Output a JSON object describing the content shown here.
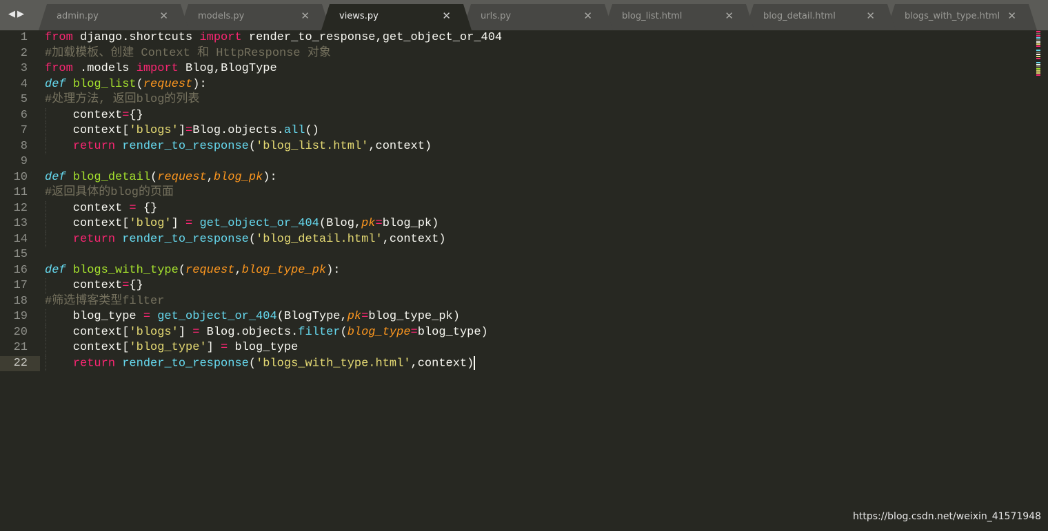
{
  "tabs": [
    {
      "label": "admin.py",
      "active": false
    },
    {
      "label": "models.py",
      "active": false
    },
    {
      "label": "views.py",
      "active": true
    },
    {
      "label": "urls.py",
      "active": false
    },
    {
      "label": "blog_list.html",
      "active": false
    },
    {
      "label": "blog_detail.html",
      "active": false
    },
    {
      "label": "blogs_with_type.html",
      "active": false
    }
  ],
  "nav": {
    "back_icon": "triangle-left",
    "forward_icon": "triangle-right",
    "back": "◀",
    "forward": "▶"
  },
  "close_glyph": "✕",
  "current_line": 22,
  "colors": {
    "background": "#272822",
    "keyword": "#f92672",
    "function": "#a6e22e",
    "def": "#66d9ef",
    "param": "#fd971f",
    "string": "#e6db74",
    "comment": "#75715e"
  },
  "code": {
    "lines": [
      {
        "n": "1",
        "tokens": [
          {
            "t": "kw",
            "s": "from"
          },
          {
            "t": "",
            "s": " django.shortcuts "
          },
          {
            "t": "kw",
            "s": "import"
          },
          {
            "t": "",
            "s": " render_to_response,get_object_or_404"
          }
        ]
      },
      {
        "n": "2",
        "tokens": [
          {
            "t": "cm",
            "s": "#加载模板、创建 Context 和 HttpResponse 对象"
          }
        ]
      },
      {
        "n": "3",
        "tokens": [
          {
            "t": "kw",
            "s": "from"
          },
          {
            "t": "",
            "s": " .models "
          },
          {
            "t": "kw",
            "s": "import"
          },
          {
            "t": "",
            "s": " Blog,BlogType"
          }
        ]
      },
      {
        "n": "4",
        "tokens": [
          {
            "t": "def",
            "s": "def"
          },
          {
            "t": "",
            "s": " "
          },
          {
            "t": "fn",
            "s": "blog_list"
          },
          {
            "t": "",
            "s": "("
          },
          {
            "t": "param",
            "s": "request"
          },
          {
            "t": "",
            "s": "):"
          }
        ]
      },
      {
        "n": "5",
        "tokens": [
          {
            "t": "cm",
            "s": "#处理方法, 返回blog的列表"
          }
        ]
      },
      {
        "n": "6",
        "tokens": [
          {
            "t": "",
            "s": "    context"
          },
          {
            "t": "op",
            "s": "="
          },
          {
            "t": "",
            "s": "{}"
          }
        ]
      },
      {
        "n": "7",
        "tokens": [
          {
            "t": "",
            "s": "    context["
          },
          {
            "t": "str",
            "s": "'blogs'"
          },
          {
            "t": "",
            "s": "]"
          },
          {
            "t": "op",
            "s": "="
          },
          {
            "t": "",
            "s": "Blog.objects."
          },
          {
            "t": "call",
            "s": "all"
          },
          {
            "t": "",
            "s": "()"
          }
        ]
      },
      {
        "n": "8",
        "tokens": [
          {
            "t": "",
            "s": "    "
          },
          {
            "t": "kw",
            "s": "return"
          },
          {
            "t": "",
            "s": " "
          },
          {
            "t": "call",
            "s": "render_to_response"
          },
          {
            "t": "",
            "s": "("
          },
          {
            "t": "str",
            "s": "'blog_list.html'"
          },
          {
            "t": "",
            "s": ",context)"
          }
        ]
      },
      {
        "n": "9",
        "tokens": []
      },
      {
        "n": "10",
        "tokens": [
          {
            "t": "def",
            "s": "def"
          },
          {
            "t": "",
            "s": " "
          },
          {
            "t": "fn",
            "s": "blog_detail"
          },
          {
            "t": "",
            "s": "("
          },
          {
            "t": "param",
            "s": "request"
          },
          {
            "t": "",
            "s": ","
          },
          {
            "t": "param",
            "s": "blog_pk"
          },
          {
            "t": "",
            "s": "):"
          }
        ]
      },
      {
        "n": "11",
        "tokens": [
          {
            "t": "cm",
            "s": "#返回具体的blog的页面"
          }
        ]
      },
      {
        "n": "12",
        "tokens": [
          {
            "t": "",
            "s": "    context "
          },
          {
            "t": "op",
            "s": "="
          },
          {
            "t": "",
            "s": " {}"
          }
        ]
      },
      {
        "n": "13",
        "tokens": [
          {
            "t": "",
            "s": "    context["
          },
          {
            "t": "str",
            "s": "'blog'"
          },
          {
            "t": "",
            "s": "] "
          },
          {
            "t": "op",
            "s": "="
          },
          {
            "t": "",
            "s": " "
          },
          {
            "t": "call",
            "s": "get_object_or_404"
          },
          {
            "t": "",
            "s": "(Blog,"
          },
          {
            "t": "param",
            "s": "pk"
          },
          {
            "t": "op",
            "s": "="
          },
          {
            "t": "",
            "s": "blog_pk)"
          }
        ]
      },
      {
        "n": "14",
        "tokens": [
          {
            "t": "",
            "s": "    "
          },
          {
            "t": "kw",
            "s": "return"
          },
          {
            "t": "",
            "s": " "
          },
          {
            "t": "call",
            "s": "render_to_response"
          },
          {
            "t": "",
            "s": "("
          },
          {
            "t": "str",
            "s": "'blog_detail.html'"
          },
          {
            "t": "",
            "s": ",context)"
          }
        ]
      },
      {
        "n": "15",
        "tokens": []
      },
      {
        "n": "16",
        "tokens": [
          {
            "t": "def",
            "s": "def"
          },
          {
            "t": "",
            "s": " "
          },
          {
            "t": "fn",
            "s": "blogs_with_type"
          },
          {
            "t": "",
            "s": "("
          },
          {
            "t": "param",
            "s": "request"
          },
          {
            "t": "",
            "s": ","
          },
          {
            "t": "param",
            "s": "blog_type_pk"
          },
          {
            "t": "",
            "s": "):"
          }
        ]
      },
      {
        "n": "17",
        "tokens": [
          {
            "t": "",
            "s": "    context"
          },
          {
            "t": "op",
            "s": "="
          },
          {
            "t": "",
            "s": "{}"
          }
        ]
      },
      {
        "n": "18",
        "tokens": [
          {
            "t": "cm",
            "s": "#筛选博客类型filter"
          }
        ]
      },
      {
        "n": "19",
        "tokens": [
          {
            "t": "",
            "s": "    blog_type "
          },
          {
            "t": "op",
            "s": "="
          },
          {
            "t": "",
            "s": " "
          },
          {
            "t": "call",
            "s": "get_object_or_404"
          },
          {
            "t": "",
            "s": "(BlogType,"
          },
          {
            "t": "param",
            "s": "pk"
          },
          {
            "t": "op",
            "s": "="
          },
          {
            "t": "",
            "s": "blog_type_pk)"
          }
        ]
      },
      {
        "n": "20",
        "tokens": [
          {
            "t": "",
            "s": "    context["
          },
          {
            "t": "str",
            "s": "'blogs'"
          },
          {
            "t": "",
            "s": "] "
          },
          {
            "t": "op",
            "s": "="
          },
          {
            "t": "",
            "s": " Blog.objects."
          },
          {
            "t": "call",
            "s": "filter"
          },
          {
            "t": "",
            "s": "("
          },
          {
            "t": "param",
            "s": "blog_type"
          },
          {
            "t": "op",
            "s": "="
          },
          {
            "t": "",
            "s": "blog_type)"
          }
        ]
      },
      {
        "n": "21",
        "tokens": [
          {
            "t": "",
            "s": "    context["
          },
          {
            "t": "str",
            "s": "'blog_type'"
          },
          {
            "t": "",
            "s": "] "
          },
          {
            "t": "op",
            "s": "="
          },
          {
            "t": "",
            "s": " blog_type"
          }
        ]
      },
      {
        "n": "22",
        "tokens": [
          {
            "t": "",
            "s": "    "
          },
          {
            "t": "kw",
            "s": "return"
          },
          {
            "t": "",
            "s": " "
          },
          {
            "t": "call",
            "s": "render_to_response"
          },
          {
            "t": "",
            "s": "("
          },
          {
            "t": "str",
            "s": "'blogs_with_type.html'"
          },
          {
            "t": "",
            "s": ",context)"
          }
        ]
      }
    ]
  },
  "watermark": "https://blog.csdn.net/weixin_41571948"
}
